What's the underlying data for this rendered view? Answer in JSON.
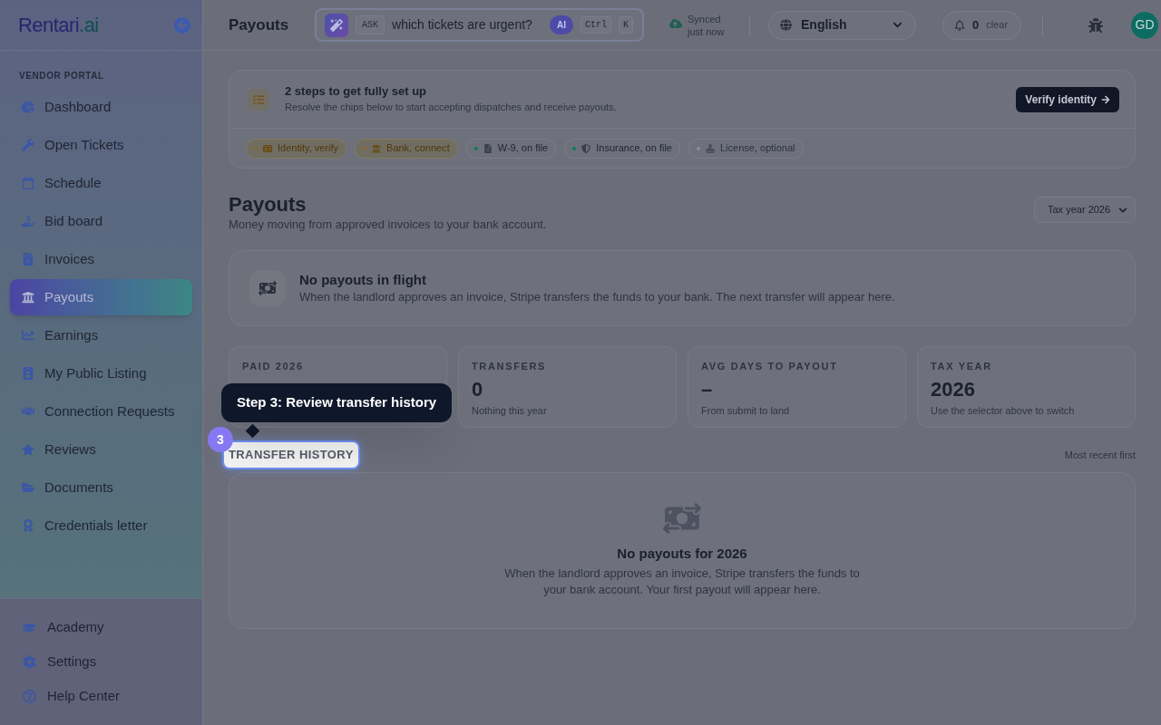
{
  "sidebar": {
    "logo": {
      "name": "Rentari",
      "suffix": ".ai"
    },
    "section_label": "VENDOR PORTAL",
    "items": [
      {
        "label": "Dashboard",
        "selected": false
      },
      {
        "label": "Open Tickets",
        "selected": false
      },
      {
        "label": "Schedule",
        "selected": false
      },
      {
        "label": "Bid board",
        "selected": false
      },
      {
        "label": "Invoices",
        "selected": false
      },
      {
        "label": "Payouts",
        "selected": true
      },
      {
        "label": "Earnings",
        "selected": false
      },
      {
        "label": "My Public Listing",
        "selected": false
      },
      {
        "label": "Connection Requests",
        "selected": false
      },
      {
        "label": "Reviews",
        "selected": false
      },
      {
        "label": "Documents",
        "selected": false
      },
      {
        "label": "Credentials letter",
        "selected": false
      }
    ],
    "footer_items": [
      {
        "label": "Academy"
      },
      {
        "label": "Settings"
      },
      {
        "label": "Help Center"
      }
    ]
  },
  "topbar": {
    "title": "Payouts",
    "search": {
      "tag": "ASK",
      "placeholder": "which tickets are urgent?",
      "badge": "AI",
      "shortcut": [
        "Ctrl",
        "K"
      ]
    },
    "sync_status": "Synced just now",
    "language": "English",
    "notifications": {
      "count": "0",
      "action": "clear"
    },
    "avatar": "GD"
  },
  "setup": {
    "title": "2 steps to get fully set up",
    "description": "Resolve the chips below to start accepting dispatches and receive payouts.",
    "button": "Verify identity",
    "chips": [
      {
        "label": "Identity, verify",
        "kind": "todo"
      },
      {
        "label": "Bank, connect",
        "kind": "todo"
      },
      {
        "label": "W-9, on file",
        "kind": "done"
      },
      {
        "label": "Insurance, on file",
        "kind": "done"
      },
      {
        "label": "License, optional",
        "kind": "optional"
      }
    ]
  },
  "page": {
    "title": "Payouts",
    "subtitle": "Money moving from approved invoices to your bank account.",
    "year_select": "Tax year 2026"
  },
  "in_flight": {
    "title": "No payouts in flight",
    "description": "When the landlord approves an invoice, Stripe transfers the funds to your bank. The next transfer will appear here."
  },
  "stats": [
    {
      "label": "PAID 2026"
    },
    {
      "label": "TRANSFERS",
      "value": "0",
      "note": "Nothing this year"
    },
    {
      "label": "AVG DAYS TO PAYOUT",
      "value": "–",
      "note": "From submit to land"
    },
    {
      "label": "TAX YEAR",
      "value": "2026",
      "note": "Use the selector above to switch"
    }
  ],
  "history": {
    "title": "TRANSFER HISTORY",
    "highlighted": true,
    "sort": "Most recent first",
    "empty_title": "No payouts for 2026",
    "empty_description": "When the landlord approves an invoice, Stripe transfers the funds to your bank account. Your first payout will appear here."
  },
  "tour": {
    "step": "3",
    "text": "Step 3: Review transfer history"
  }
}
